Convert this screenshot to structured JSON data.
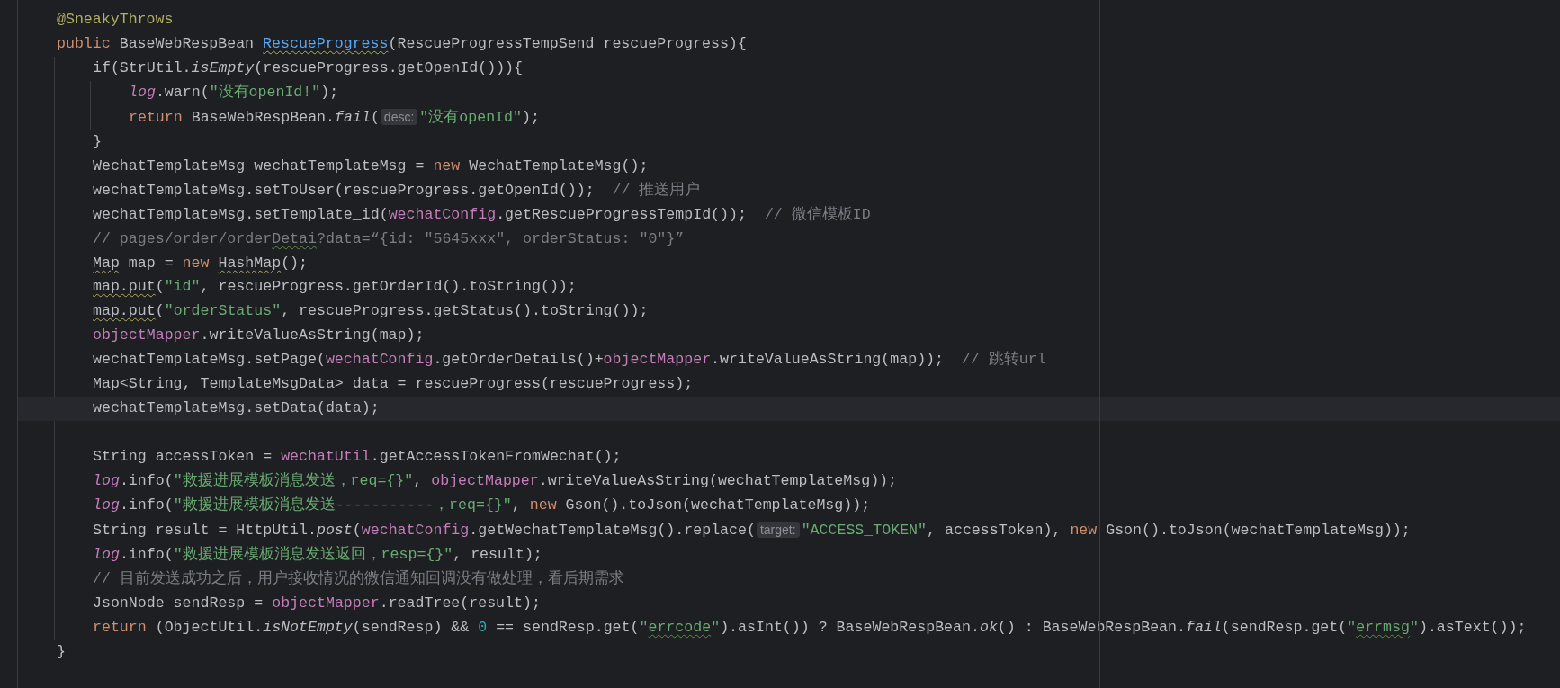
{
  "lines": [
    {
      "current": false,
      "tokens": [
        {
          "kind": "annotation",
          "text": "@SneakyThrows"
        }
      ]
    },
    {
      "current": false,
      "tokens": [
        {
          "kind": "keyword",
          "text": "public"
        },
        {
          "kind": "plain",
          "text": " BaseWebRespBean "
        },
        {
          "kind": "declaration",
          "text": "RescueProgress",
          "warning": true
        },
        {
          "kind": "plain",
          "text": "(RescueProgressTempSend rescueProgress){"
        }
      ],
      "children": [
        {
          "current": false,
          "tokens": [
            {
              "kind": "plain",
              "text": "if(StrUtil."
            },
            {
              "kind": "static-method",
              "text": "isEmpty"
            },
            {
              "kind": "plain",
              "text": "(rescueProgress.getOpenId())){"
            }
          ],
          "children": [
            {
              "current": false,
              "tokens": [
                {
                  "kind": "static-field",
                  "text": "log"
                },
                {
                  "kind": "plain",
                  "text": ".warn("
                },
                {
                  "kind": "string",
                  "text": "\"没有openId!\""
                },
                {
                  "kind": "plain",
                  "text": ");"
                }
              ]
            },
            {
              "current": false,
              "tokens": [
                {
                  "kind": "keyword",
                  "text": "return"
                },
                {
                  "kind": "plain",
                  "text": " BaseWebRespBean."
                },
                {
                  "kind": "static-method",
                  "text": "fail"
                },
                {
                  "kind": "plain",
                  "text": "("
                },
                {
                  "kind": "hint",
                  "text": "desc:"
                },
                {
                  "kind": "string",
                  "text": "\"没有openId\""
                },
                {
                  "kind": "plain",
                  "text": ");"
                }
              ]
            }
          ]
        },
        {
          "current": false,
          "tokens": [
            {
              "kind": "plain",
              "text": "}"
            }
          ]
        },
        {
          "current": false,
          "tokens": [
            {
              "kind": "plain",
              "text": "WechatTemplateMsg wechatTemplateMsg = "
            },
            {
              "kind": "keyword",
              "text": "new"
            },
            {
              "kind": "plain",
              "text": " WechatTemplateMsg();"
            }
          ]
        },
        {
          "current": false,
          "tokens": [
            {
              "kind": "plain",
              "text": "wechatTemplateMsg.setToUser(rescueProgress.getOpenId());  "
            },
            {
              "kind": "comment",
              "text": "// 推送用户"
            }
          ]
        },
        {
          "current": false,
          "tokens": [
            {
              "kind": "plain",
              "text": "wechatTemplateMsg.setTemplate_id("
            },
            {
              "kind": "field",
              "text": "wechatConfig"
            },
            {
              "kind": "plain",
              "text": ".getRescueProgressTempId());  "
            },
            {
              "kind": "comment",
              "text": "// 微信模板ID"
            }
          ]
        },
        {
          "current": false,
          "tokens": [
            {
              "kind": "comment",
              "text": "// pages/order/order"
            },
            {
              "kind": "comment",
              "text": "Detai",
              "typo": true
            },
            {
              "kind": "comment",
              "text": "?data=“{id: \"5645xxx\", orderStatus: \"0\"}”"
            }
          ]
        },
        {
          "current": false,
          "tokens": [
            {
              "kind": "plain",
              "text": "Map",
              "warning": true
            },
            {
              "kind": "plain",
              "text": " map = "
            },
            {
              "kind": "keyword",
              "text": "new "
            },
            {
              "kind": "plain",
              "text": "HashMap",
              "warning": true
            },
            {
              "kind": "plain",
              "text": "();"
            }
          ]
        },
        {
          "current": false,
          "tokens": [
            {
              "kind": "plain",
              "text": "map.put",
              "warning": true
            },
            {
              "kind": "plain",
              "text": "("
            },
            {
              "kind": "string",
              "text": "\"id\""
            },
            {
              "kind": "plain",
              "text": ", rescueProgress.getOrderId().toString());"
            }
          ]
        },
        {
          "current": false,
          "tokens": [
            {
              "kind": "plain",
              "text": "map.put",
              "warning": true
            },
            {
              "kind": "plain",
              "text": "("
            },
            {
              "kind": "string",
              "text": "\"orderStatus\""
            },
            {
              "kind": "plain",
              "text": ", rescueProgress.getStatus().toString());"
            }
          ]
        },
        {
          "current": false,
          "tokens": [
            {
              "kind": "field",
              "text": "objectMapper"
            },
            {
              "kind": "plain",
              "text": ".writeValueAsString(map);"
            }
          ]
        },
        {
          "current": false,
          "tokens": [
            {
              "kind": "plain",
              "text": "wechatTemplateMsg.setPage("
            },
            {
              "kind": "field",
              "text": "wechatConfig"
            },
            {
              "kind": "plain",
              "text": ".getOrderDetails()+"
            },
            {
              "kind": "field",
              "text": "objectMapper"
            },
            {
              "kind": "plain",
              "text": ".writeValueAsString(map));  "
            },
            {
              "kind": "comment",
              "text": "// 跳转url"
            }
          ]
        },
        {
          "current": false,
          "tokens": [
            {
              "kind": "plain",
              "text": "Map<String, TemplateMsgData> data = rescueProgress(rescueProgress);"
            }
          ]
        },
        {
          "current": true,
          "tokens": [
            {
              "kind": "plain",
              "text": "wechatTemplateMsg.setData(data);"
            }
          ]
        },
        {
          "current": false
        },
        {
          "current": false,
          "tokens": [
            {
              "kind": "plain",
              "text": "String accessToken = "
            },
            {
              "kind": "field",
              "text": "wechatUtil"
            },
            {
              "kind": "plain",
              "text": ".getAccessTokenFromWechat();"
            }
          ]
        },
        {
          "current": false,
          "tokens": [
            {
              "kind": "static-field",
              "text": "log"
            },
            {
              "kind": "plain",
              "text": ".info("
            },
            {
              "kind": "string",
              "text": "\"救援进展模板消息发送，req={}\""
            },
            {
              "kind": "plain",
              "text": ", "
            },
            {
              "kind": "field",
              "text": "objectMapper"
            },
            {
              "kind": "plain",
              "text": ".writeValueAsString(wechatTemplateMsg));"
            }
          ]
        },
        {
          "current": false,
          "tokens": [
            {
              "kind": "static-field",
              "text": "log"
            },
            {
              "kind": "plain",
              "text": ".info("
            },
            {
              "kind": "string",
              "text": "\"救援进展模板消息发送-----------，req={}\""
            },
            {
              "kind": "plain",
              "text": ", "
            },
            {
              "kind": "keyword",
              "text": "new"
            },
            {
              "kind": "plain",
              "text": " Gson().toJson(wechatTemplateMsg));"
            }
          ]
        },
        {
          "current": false,
          "tokens": [
            {
              "kind": "plain",
              "text": "String result = HttpUtil."
            },
            {
              "kind": "static-method",
              "text": "post"
            },
            {
              "kind": "plain",
              "text": "("
            },
            {
              "kind": "field",
              "text": "wechatConfig"
            },
            {
              "kind": "plain",
              "text": ".getWechatTemplateMsg().replace("
            },
            {
              "kind": "hint",
              "text": "target:"
            },
            {
              "kind": "string",
              "text": "\"ACCESS_TOKEN\""
            },
            {
              "kind": "plain",
              "text": ", accessToken), "
            },
            {
              "kind": "keyword",
              "text": "new"
            },
            {
              "kind": "plain",
              "text": " Gson().toJson(wechatTemplateMsg));"
            }
          ]
        },
        {
          "current": false,
          "tokens": [
            {
              "kind": "static-field",
              "text": "log"
            },
            {
              "kind": "plain",
              "text": ".info("
            },
            {
              "kind": "string",
              "text": "\"救援进展模板消息发送返回，resp={}\""
            },
            {
              "kind": "plain",
              "text": ", result);"
            }
          ]
        },
        {
          "current": false,
          "tokens": [
            {
              "kind": "comment",
              "text": "// 目前发送成功之后，用户接收情况的微信通知回调没有做处理，看后期需求"
            }
          ]
        },
        {
          "current": false,
          "tokens": [
            {
              "kind": "plain",
              "text": "JsonNode sendResp = "
            },
            {
              "kind": "field",
              "text": "objectMapper"
            },
            {
              "kind": "plain",
              "text": ".readTree(result);"
            }
          ]
        },
        {
          "current": false,
          "tokens": [
            {
              "kind": "keyword",
              "text": "return"
            },
            {
              "kind": "plain",
              "text": " (ObjectUtil."
            },
            {
              "kind": "static-method",
              "text": "isNotEmpty"
            },
            {
              "kind": "plain",
              "text": "(sendResp) && "
            },
            {
              "kind": "number",
              "text": "0"
            },
            {
              "kind": "plain",
              "text": " == sendResp.get("
            },
            {
              "kind": "string",
              "text": "\""
            },
            {
              "kind": "string",
              "text": "errcode",
              "typo": true
            },
            {
              "kind": "string",
              "text": "\""
            },
            {
              "kind": "plain",
              "text": ").asInt()) ? BaseWebRespBean."
            },
            {
              "kind": "static-method",
              "text": "ok"
            },
            {
              "kind": "plain",
              "text": "() : BaseWebRespBean."
            },
            {
              "kind": "static-method",
              "text": "fail"
            },
            {
              "kind": "plain",
              "text": "(sendResp.get("
            },
            {
              "kind": "string",
              "text": "\""
            },
            {
              "kind": "string",
              "text": "errmsg",
              "typo": true
            },
            {
              "kind": "string",
              "text": "\""
            },
            {
              "kind": "plain",
              "text": ").asText());"
            }
          ]
        }
      ]
    },
    {
      "current": false,
      "tokens": [
        {
          "kind": "plain",
          "text": "}"
        }
      ]
    }
  ]
}
